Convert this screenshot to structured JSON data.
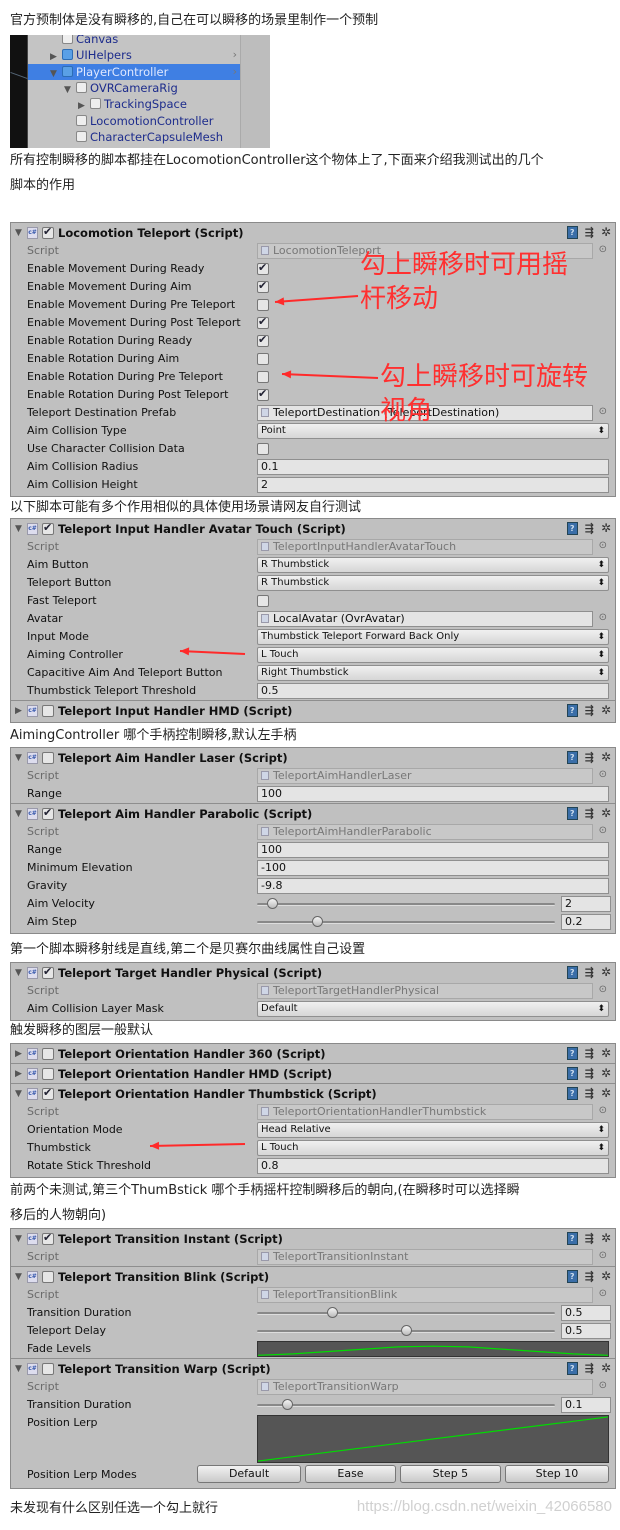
{
  "texts": [
    {
      "lines": [
        "官方预制体是没有瞬移的,自己在可以瞬移的场景里制作一个预制"
      ]
    },
    {
      "lines": [
        "所有控制瞬移的脚本都挂在LocomotionController这个物体上了,下面来介绍我测试出的几个",
        "脚本的作用"
      ]
    },
    {
      "lines": [
        "以下脚本可能有多个作用相似的具体使用场景请网友自行测试"
      ]
    },
    {
      "lines": [
        "AimingController 哪个手柄控制瞬移,默认左手柄"
      ]
    },
    {
      "lines": [
        "第一个脚本瞬移射线是直线,第二个是贝赛尔曲线属性自己设置"
      ]
    },
    {
      "lines": [
        "触发瞬移的图层一般默认"
      ]
    },
    {
      "lines": [
        "前两个未测试,第三个ThumBstick 哪个手柄摇杆控制瞬移后的朝向,(在瞬移时可以选择瞬",
        "移后的人物朝向)"
      ]
    },
    {
      "lines": [
        "未发现有什么区别任选一个勾上就行"
      ]
    }
  ],
  "watermark": "https://blog.csdn.net/weixin_42066580",
  "hierarchy": {
    "items": [
      {
        "label": "Canvas",
        "expand": "none",
        "prefab": false
      },
      {
        "label": "UIHelpers",
        "expand": "collapsed",
        "prefab": true,
        "chevron": true
      },
      {
        "label": "PlayerController",
        "expand": "expanded",
        "prefab": true,
        "chevron": true,
        "selected": true
      },
      {
        "label": "OVRCameraRig",
        "expand": "expanded",
        "prefab": false,
        "indent": 1
      },
      {
        "label": "TrackingSpace",
        "expand": "collapsed",
        "prefab": false,
        "indent": 2
      },
      {
        "label": "LocomotionController",
        "expand": "none",
        "prefab": false,
        "indent": 1
      },
      {
        "label": "CharacterCapsuleMesh",
        "expand": "none",
        "prefab": false,
        "indent": 1
      }
    ]
  },
  "annotations": [
    {
      "lines": [
        "勾上瞬移时可用摇",
        "杆移动"
      ],
      "color": "#ff3030"
    },
    {
      "lines": [
        "勾上瞬移时可旋转",
        "视角"
      ],
      "color": "#ff3030"
    }
  ],
  "panels": [
    {
      "components": [
        {
          "title": "Locomotion Teleport (Script)",
          "enabled": true,
          "expanded": true,
          "rows": [
            {
              "label": "Script",
              "type": "script",
              "value": "LocomotionTeleport"
            },
            {
              "label": "Enable Movement During Ready",
              "type": "check",
              "value": true
            },
            {
              "label": "Enable Movement During Aim",
              "type": "check",
              "value": true
            },
            {
              "label": "Enable Movement During Pre Teleport",
              "type": "check",
              "value": false
            },
            {
              "label": "Enable Movement During Post Teleport",
              "type": "check",
              "value": true
            },
            {
              "label": "Enable Rotation During Ready",
              "type": "check",
              "value": true
            },
            {
              "label": "Enable Rotation During Aim",
              "type": "check",
              "value": false
            },
            {
              "label": "Enable Rotation During Pre Teleport",
              "type": "check",
              "value": false
            },
            {
              "label": "Enable Rotation During Post Teleport",
              "type": "check",
              "value": true
            },
            {
              "label": "Teleport Destination Prefab",
              "type": "object",
              "value": "TeleportDestination (TeleportDestination)"
            },
            {
              "label": "Aim Collision Type",
              "type": "dropdown",
              "value": "Point"
            },
            {
              "label": "Use Character Collision Data",
              "type": "check",
              "value": false
            },
            {
              "label": "Aim Collision Radius",
              "type": "field",
              "value": "0.1"
            },
            {
              "label": "Aim Collision Height",
              "type": "field",
              "value": "2"
            }
          ]
        }
      ]
    },
    {
      "components": [
        {
          "title": "Teleport Input Handler Avatar Touch (Script)",
          "enabled": true,
          "expanded": true,
          "rows": [
            {
              "label": "Script",
              "type": "script",
              "value": "TeleportInputHandlerAvatarTouch"
            },
            {
              "label": "Aim Button",
              "type": "dropdown",
              "value": "R Thumbstick"
            },
            {
              "label": "Teleport Button",
              "type": "dropdown",
              "value": "R Thumbstick"
            },
            {
              "label": "Fast Teleport",
              "type": "check",
              "value": false
            },
            {
              "label": "Avatar",
              "type": "object",
              "value": "LocalAvatar (OvrAvatar)"
            },
            {
              "label": "Input Mode",
              "type": "dropdown",
              "value": "Thumbstick Teleport Forward Back Only"
            },
            {
              "label": "Aiming Controller",
              "type": "dropdown",
              "value": "L Touch"
            },
            {
              "label": "Capacitive Aim And Teleport Button",
              "type": "dropdown",
              "value": "Right Thumbstick"
            },
            {
              "label": "Thumbstick Teleport Threshold",
              "type": "field",
              "value": "0.5"
            }
          ]
        },
        {
          "title": "Teleport Input Handler HMD (Script)",
          "enabled": false,
          "expanded": false,
          "rows": []
        }
      ]
    },
    {
      "components": [
        {
          "title": "Teleport Aim Handler Laser (Script)",
          "enabled": false,
          "expanded": true,
          "rows": [
            {
              "label": "Script",
              "type": "script",
              "value": "TeleportAimHandlerLaser"
            },
            {
              "label": "Range",
              "type": "field",
              "value": "100"
            }
          ]
        },
        {
          "title": "Teleport Aim Handler Parabolic (Script)",
          "enabled": true,
          "expanded": true,
          "rows": [
            {
              "label": "Script",
              "type": "script",
              "value": "TeleportAimHandlerParabolic"
            },
            {
              "label": "Range",
              "type": "field",
              "value": "100"
            },
            {
              "label": "Minimum Elevation",
              "type": "field",
              "value": "-100"
            },
            {
              "label": "Gravity",
              "type": "field",
              "value": "-9.8"
            },
            {
              "label": "Aim Velocity",
              "type": "slider",
              "value": "2",
              "level": 0.05
            },
            {
              "label": "Aim Step",
              "type": "slider",
              "value": "0.2",
              "level": 0.2
            }
          ]
        }
      ]
    },
    {
      "components": [
        {
          "title": "Teleport Target Handler Physical (Script)",
          "enabled": true,
          "expanded": true,
          "rows": [
            {
              "label": "Script",
              "type": "script",
              "value": "TeleportTargetHandlerPhysical"
            },
            {
              "label": "Aim Collision Layer Mask",
              "type": "dropdown",
              "value": "Default"
            }
          ]
        }
      ]
    },
    {
      "components": [
        {
          "title": "Teleport Orientation Handler 360 (Script)",
          "enabled": false,
          "expanded": false,
          "rows": []
        },
        {
          "title": "Teleport Orientation Handler HMD (Script)",
          "enabled": false,
          "expanded": false,
          "rows": []
        },
        {
          "title": "Teleport Orientation Handler Thumbstick (Script)",
          "enabled": true,
          "expanded": true,
          "rows": [
            {
              "label": "Script",
              "type": "script",
              "value": "TeleportOrientationHandlerThumbstick"
            },
            {
              "label": "Orientation Mode",
              "type": "dropdown",
              "value": "Head Relative"
            },
            {
              "label": "Thumbstick",
              "type": "dropdown",
              "value": "L Touch"
            },
            {
              "label": "Rotate Stick Threshold",
              "type": "field",
              "value": "0.8"
            }
          ]
        }
      ]
    },
    {
      "components": [
        {
          "title": "Teleport Transition Instant (Script)",
          "enabled": true,
          "expanded": true,
          "rows": [
            {
              "label": "Script",
              "type": "script",
              "value": "TeleportTransitionInstant"
            }
          ]
        },
        {
          "title": "Teleport Transition Blink (Script)",
          "enabled": false,
          "expanded": true,
          "rows": [
            {
              "label": "Script",
              "type": "script",
              "value": "TeleportTransitionBlink"
            },
            {
              "label": "Transition Duration",
              "type": "slider",
              "value": "0.5",
              "level": 0.25
            },
            {
              "label": "Teleport Delay",
              "type": "slider",
              "value": "0.5",
              "level": 0.5
            },
            {
              "label": "Fade Levels",
              "type": "curve",
              "curve": "arch",
              "curve_color": "#00dd00"
            }
          ]
        },
        {
          "title": "Teleport Transition Warp (Script)",
          "enabled": false,
          "expanded": true,
          "rows": [
            {
              "label": "Script",
              "type": "script",
              "value": "TeleportTransitionWarp"
            },
            {
              "label": "Transition Duration",
              "type": "slider",
              "value": "0.1",
              "level": 0.1
            },
            {
              "label": "Position Lerp",
              "type": "curve",
              "curve": "linear",
              "curve_color": "#00dd00",
              "tall": true
            },
            {
              "label": "Position Lerp Modes",
              "type": "buttons",
              "buttons": [
                "Default",
                "Ease",
                "Step 5",
                "Step 10"
              ]
            }
          ]
        }
      ]
    }
  ]
}
